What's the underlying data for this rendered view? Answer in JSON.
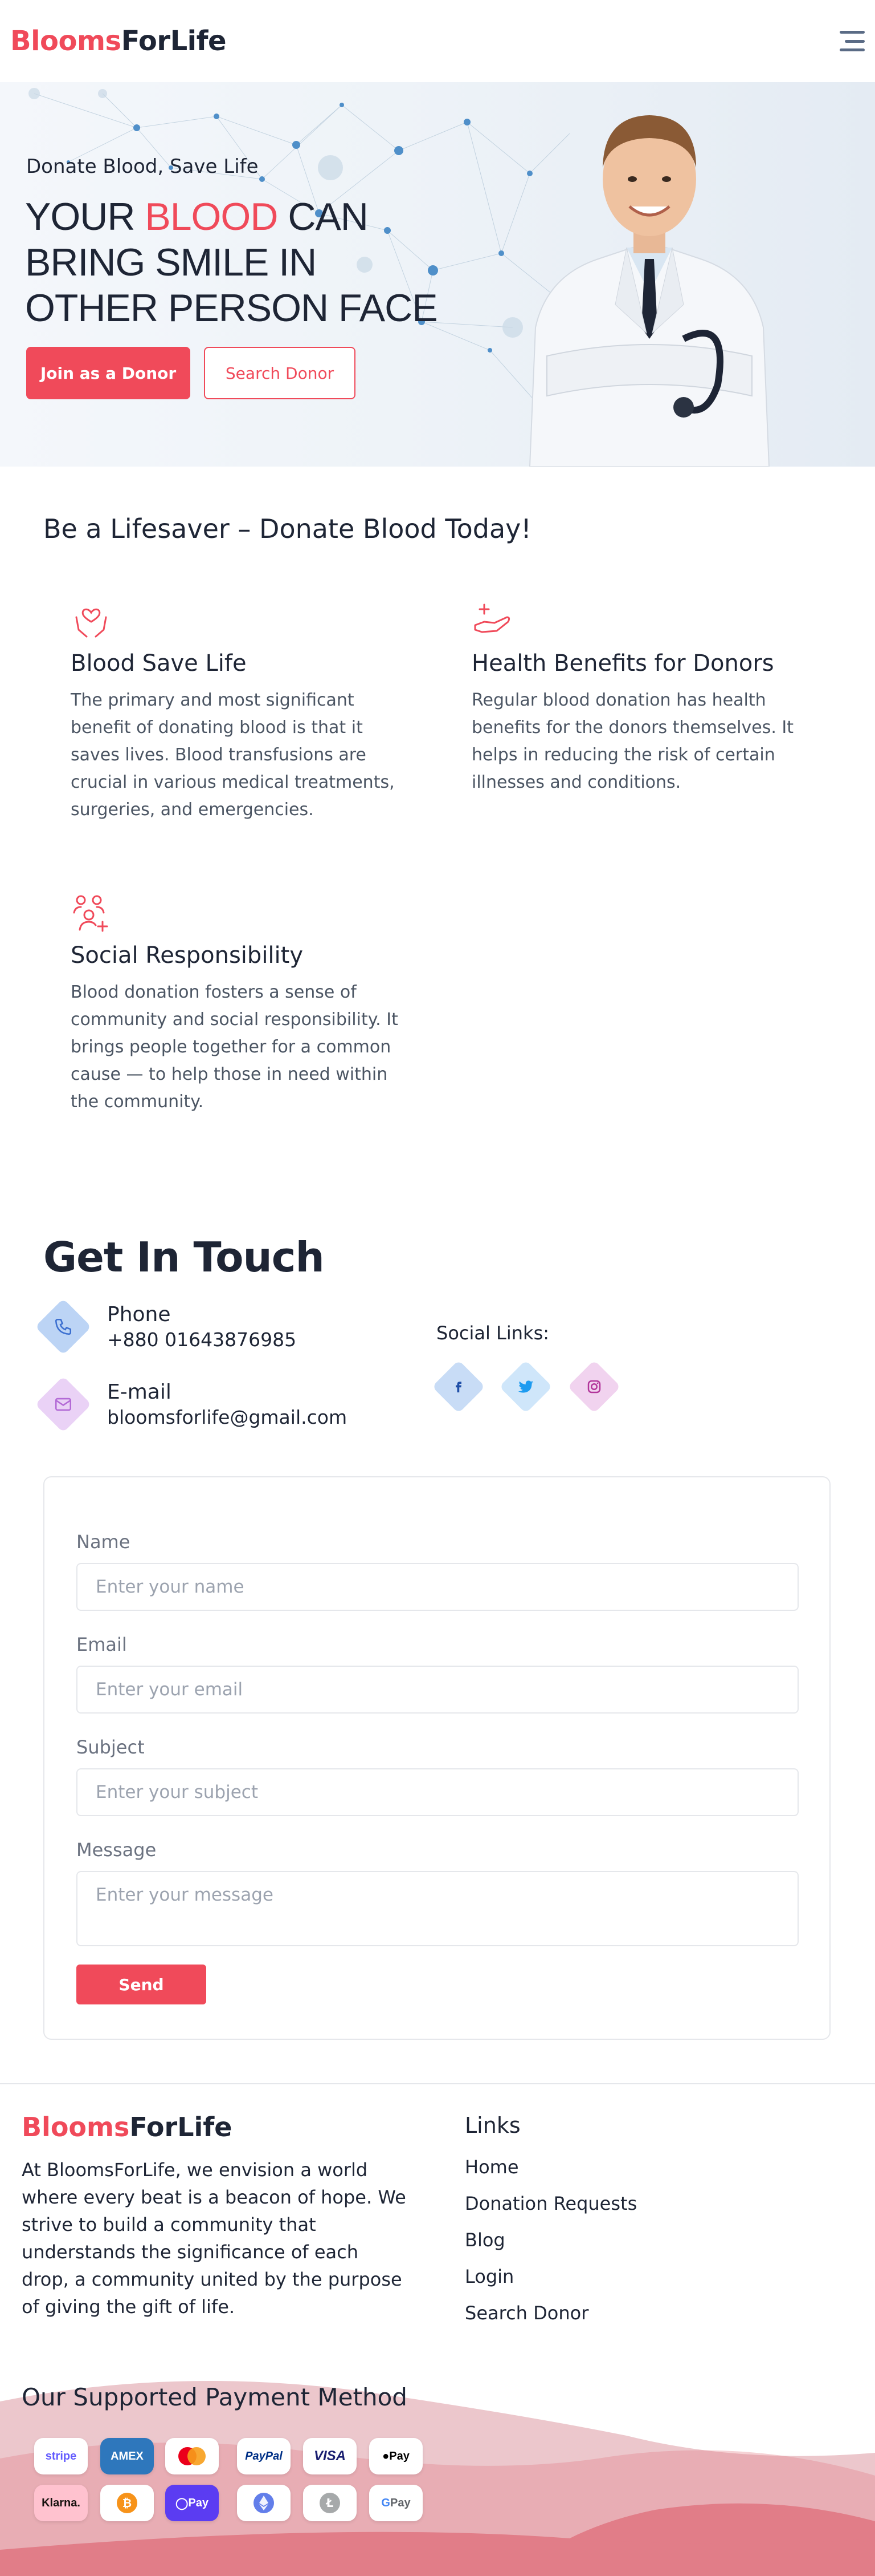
{
  "header": {
    "logo_part1": "Blooms",
    "logo_part2": "ForLife"
  },
  "hero": {
    "subtitle": "Donate Blood, Save Life",
    "title_before": "YOUR ",
    "title_highlight": "BLOOD",
    "title_after": " CAN BRING SMILE IN OTHER PERSON FACE",
    "primary_button": "Join as a Donor",
    "secondary_button": "Search Donor"
  },
  "features": {
    "title": "Be a Lifesaver – Donate Blood Today!",
    "items": [
      {
        "icon": "heart-hands-icon",
        "heading": "Blood Save Life",
        "text": "The primary and most significant benefit of donating blood is that it saves lives. Blood transfusions are crucial in various medical treatments, surgeries, and emergencies."
      },
      {
        "icon": "hand-plus-icon",
        "heading": "Health Benefits for Donors",
        "text": "Regular blood donation has health benefits for the donors themselves. It helps in reducing the risk of certain illnesses and conditions."
      },
      {
        "icon": "community-icon",
        "heading": "Social Responsibility",
        "text": "Blood donation fosters a sense of community and social responsibility. It brings people together for a common cause — to help those in need within the community."
      }
    ]
  },
  "contact": {
    "title": "Get In Touch",
    "phone_label": "Phone",
    "phone_value": "+880 01643876985",
    "email_label": "E-mail",
    "email_value": "bloomsforlife@gmail.com",
    "social_label": "Social Links:",
    "socials": [
      "facebook-icon",
      "twitter-icon",
      "instagram-icon"
    ]
  },
  "form": {
    "name_label": "Name",
    "name_placeholder": "Enter your name",
    "email_label": "Email",
    "email_placeholder": "Enter your email",
    "subject_label": "Subject",
    "subject_placeholder": "Enter your subject",
    "message_label": "Message",
    "message_placeholder": "Enter your message",
    "send_button": "Send"
  },
  "footer": {
    "logo_part1": "Blooms",
    "logo_part2": "ForLife",
    "description": "At BloomsForLife, we envision a world where every beat is a beacon of hope. We strive to build a community that understands the significance of each drop, a community united by the purpose of giving the gift of life.",
    "links_title": "Links",
    "links": [
      "Home",
      "Donation Requests",
      "Blog",
      "Login",
      "Search Donor"
    ],
    "payment_title": "Our Supported Payment Method",
    "payments": [
      {
        "name": "stripe",
        "label": "stripe",
        "color": "#635bff"
      },
      {
        "name": "amex",
        "label": "AMEX",
        "color": "#2e77bc"
      },
      {
        "name": "mastercard",
        "label": "",
        "color": "#eb001b"
      },
      {
        "name": "paypal",
        "label": "PayPal",
        "color": "#003087"
      },
      {
        "name": "visa",
        "label": "VISA",
        "color": "#1a1f71"
      },
      {
        "name": "apple-pay",
        "label": "Pay",
        "color": "#000000"
      },
      {
        "name": "klarna",
        "label": "Klarna.",
        "color": "#17120f"
      },
      {
        "name": "bitcoin",
        "label": "₿",
        "color": "#f7931a"
      },
      {
        "name": "opay",
        "label": "Pay",
        "color": "#5b3cf2"
      },
      {
        "name": "ethereum",
        "label": "",
        "color": "#627eea"
      },
      {
        "name": "litecoin",
        "label": "Ł",
        "color": "#a6a9aa"
      },
      {
        "name": "google-pay",
        "label": "Pay",
        "color": "#5f6368"
      }
    ]
  },
  "colors": {
    "accent": "#f04a5a",
    "dark": "#1e2535"
  }
}
